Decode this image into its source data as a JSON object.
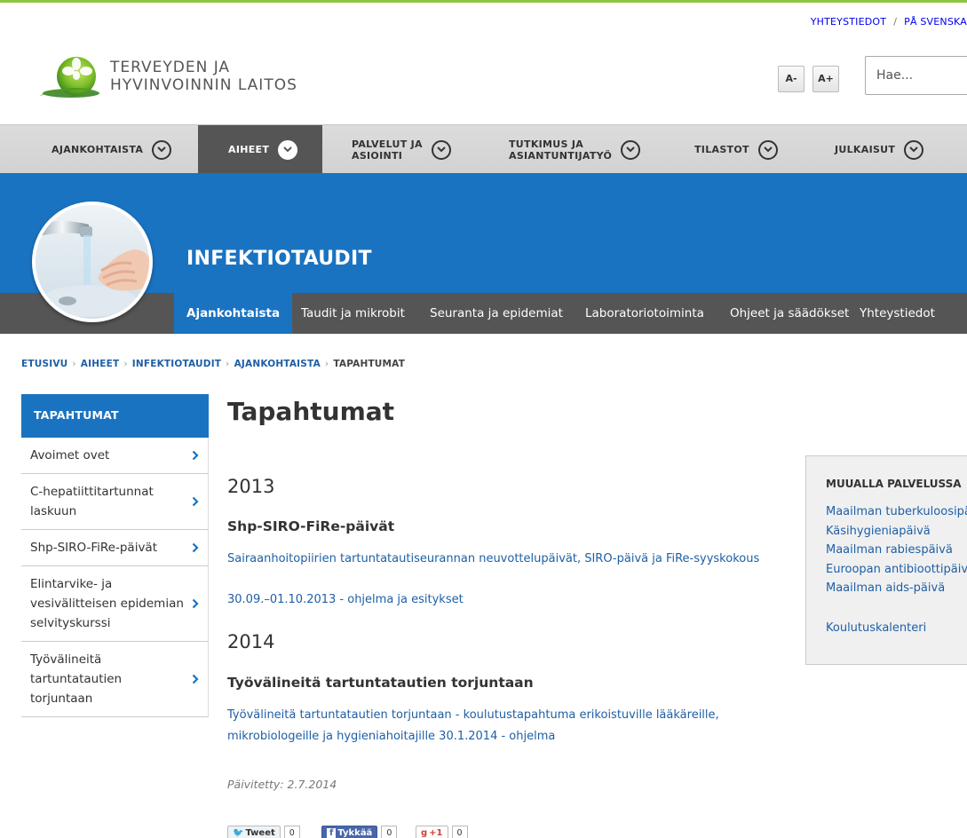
{
  "utility": {
    "contact": "YHTEYSTIEDOT",
    "separator": "/",
    "swedish": "PÅ SVENSKA"
  },
  "logo": {
    "line1": "TERVEYDEN JA",
    "line2": "HYVINVOINNIN LAITOS"
  },
  "font_size": {
    "decrease": "A-",
    "increase": "A+"
  },
  "search": {
    "placeholder": "Hae...",
    "value": ""
  },
  "main_nav": [
    {
      "label1": "AJANKOHTAISTA",
      "label2": "",
      "active": false
    },
    {
      "label1": "AIHEET",
      "label2": "",
      "active": true
    },
    {
      "label1": "PALVELUT JA",
      "label2": "ASIOINTI",
      "active": false
    },
    {
      "label1": "TUTKIMUS JA",
      "label2": "ASIANTUNTIJATYÖ",
      "active": false
    },
    {
      "label1": "TILASTOT",
      "label2": "",
      "active": false
    },
    {
      "label1": "JULKAISUT",
      "label2": "",
      "active": false
    }
  ],
  "banner": {
    "title": "INFEKTIOTAUDIT"
  },
  "sub_nav": [
    {
      "label": "Ajankohtaista",
      "active": true
    },
    {
      "label": "Taudit ja mikrobit",
      "active": false
    },
    {
      "label": "Seuranta ja epidemiat",
      "active": false
    },
    {
      "label": "Laboratoriotoiminta",
      "active": false
    },
    {
      "label": "Ohjeet ja säädökset",
      "active": false
    },
    {
      "label": "Yhteystiedot",
      "active": false
    }
  ],
  "breadcrumb": [
    "ETUSIVU",
    "AIHEET",
    "INFEKTIOTAUDIT",
    "AJANKOHTAISTA",
    "TAPAHTUMAT"
  ],
  "sidebar": {
    "heading": "TAPAHTUMAT",
    "items": [
      {
        "label": "Avoimet ovet"
      },
      {
        "label": "C-hepatiittitartunnat laskuun"
      },
      {
        "label": "Shp-SIRO-FiRe-päivät"
      },
      {
        "label": "Elintarvike- ja vesivälitteisen epidemian selvityskurssi"
      },
      {
        "label": "Työvälineitä tartuntatautien torjuntaan"
      }
    ]
  },
  "main": {
    "title": "Tapahtumat",
    "sections": [
      {
        "year": "2013",
        "event_title": "Shp-SIRO-FiRe-päivät",
        "link1": "Sairaanhoitopiirien tartuntatautiseurannan neuvottelupäivät, SIRO-päivä ja FiRe-syyskokous",
        "link2": "30.09.–01.10.2013 - ohjelma ja esitykset"
      },
      {
        "year": "2014",
        "event_title": "Työvälineitä tartuntatautien torjuntaan",
        "link1": "Työvälineitä tartuntatautien torjuntaan - koulutustapahtuma erikoistuville lääkäreille, mikrobiologeille ja hygieniahoitajille 30.1.2014 - ohjelma"
      }
    ],
    "updated": "Päivitetty: 2.7.2014"
  },
  "share": {
    "tweet": "Tweet",
    "tweet_count": "0",
    "like": "Tykkää",
    "like_count": "0",
    "gplus": "+1",
    "gplus_count": "0"
  },
  "aside": {
    "heading": "MUUALLA PALVELUSSA",
    "links": [
      "Maailman tuberkuloosipäivä",
      "Käsihygieniapäivä",
      "Maailman rabiespäivä",
      "Euroopan antibioottipäivä",
      "Maailman aids-päivä"
    ],
    "calendar": "Koulutuskalenteri"
  },
  "colors": {
    "accent_blue": "#1a73c1",
    "link_blue": "#1e5fa6",
    "green": "#8cc63f",
    "dark_nav": "#555555"
  }
}
